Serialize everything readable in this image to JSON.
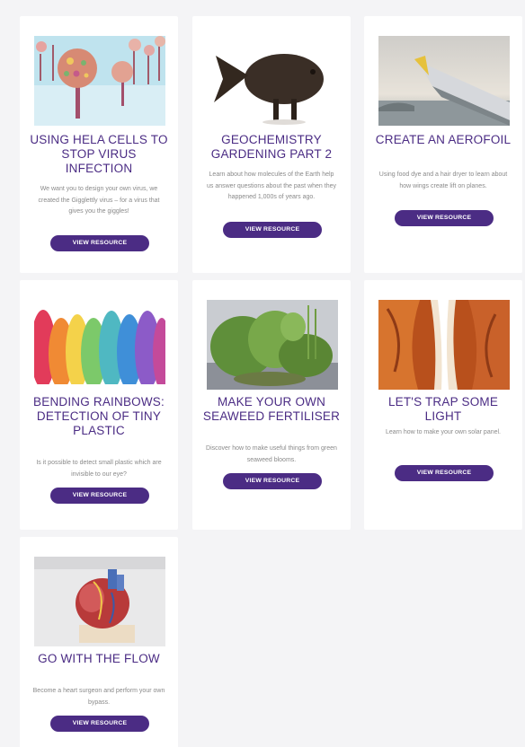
{
  "cards": [
    {
      "title": "USING HELA CELLS TO STOP VIRUS INFECTION",
      "description": "We want you to design your own virus, we created the Gigglettly virus – for a virus that gives you the giggles!",
      "button": "VIEW RESOURCE"
    },
    {
      "title": "GEOCHEMISTRY GARDENING PART 2",
      "description": "Learn about how molecules of the Earth help us answer questions about the past when they happened 1,000s of years ago.",
      "button": "VIEW RESOURCE"
    },
    {
      "title": "CREATE AN AEROFOIL",
      "description": "Using food dye and a hair dryer to learn about how wings create lift on planes.",
      "button": "VIEW RESOURCE"
    },
    {
      "title": "BENDING RAINBOWS: DETECTION OF TINY PLASTIC",
      "description": "Is it possible to detect small plastic which are invisible to our eye?",
      "button": "VIEW RESOURCE"
    },
    {
      "title": "MAKE YOUR OWN SEAWEED FERTILISER",
      "description": "Discover how to make useful things from green seaweed blooms.",
      "button": "VIEW RESOURCE"
    },
    {
      "title": "LET'S TRAP SOME LIGHT",
      "description": "Learn how to make your own solar panel.",
      "button": "VIEW RESOURCE"
    },
    {
      "title": "GO WITH THE FLOW",
      "description": "Become a heart surgeon and perform your own bypass.",
      "button": "VIEW RESOURCE"
    }
  ],
  "colors": {
    "accent": "#4b2c84",
    "card": "#ffffff",
    "background": "#f4f4f6"
  }
}
